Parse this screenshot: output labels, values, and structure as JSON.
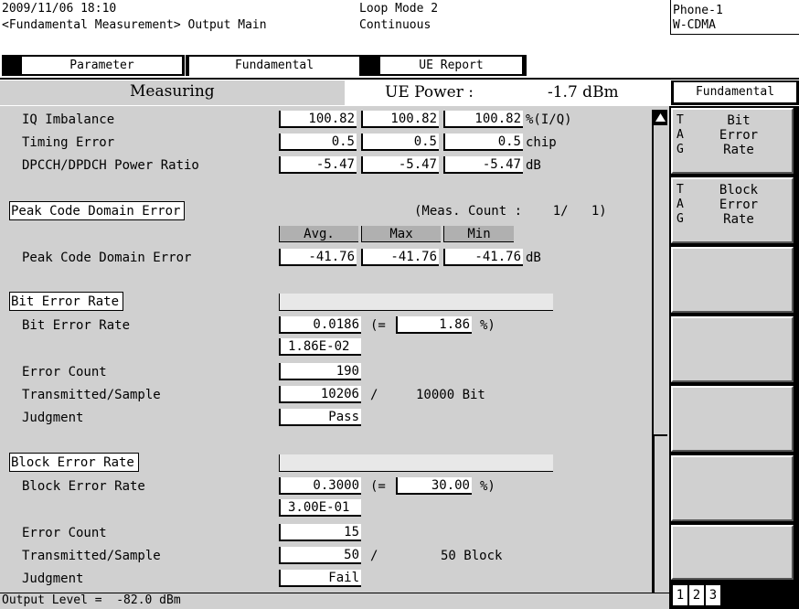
{
  "header": {
    "datetime": "2009/11/06 18:10",
    "screen_title": "<Fundamental Measurement> Output Main",
    "loop_mode": "Loop Mode 2",
    "continuous": "Continuous",
    "phone": "Phone-1",
    "system": "W-CDMA"
  },
  "tabs": [
    {
      "label": "Parameter"
    },
    {
      "label": "Fundamental"
    },
    {
      "label": "UE Report"
    }
  ],
  "status": {
    "measuring": "Measuring",
    "ue_power_label": "UE Power :",
    "ue_power_value": "-1.7 dBm"
  },
  "rows_top": [
    {
      "label": "IQ Imbalance",
      "v1": "100.82",
      "v2": "100.82",
      "v3": "100.82",
      "unit": "%(I/Q)"
    },
    {
      "label": "Timing Error",
      "v1": "0.5",
      "v2": "0.5",
      "v3": "0.5",
      "unit": "chip"
    },
    {
      "label": "DPCCH/DPDCH Power Ratio",
      "v1": "-5.47",
      "v2": "-5.47",
      "v3": "-5.47",
      "unit": "dB"
    }
  ],
  "pcde": {
    "section": "Peak Code Domain Error",
    "meas_count": "(Meas. Count :    1/   1)",
    "h_avg": "Avg.",
    "h_max": "Max",
    "h_min": "Min",
    "label": "Peak Code Domain Error",
    "v1": "-41.76",
    "v2": "-41.76",
    "v3": "-41.76",
    "unit": "dB"
  },
  "ber": {
    "section": "Bit Error Rate",
    "rate_label": "Bit Error Rate",
    "rate_value": "0.0186",
    "paren_open": "(=",
    "percent_value": "1.86",
    "paren_close": "%)",
    "exp_value": "1.86E-02",
    "count_label": "Error Count",
    "count_value": "190",
    "ts_label": "Transmitted/Sample",
    "ts_value": "10206",
    "ts_sep": "/",
    "ts_total": "10000 Bit",
    "judgment_label": "Judgment",
    "judgment_value": "Pass"
  },
  "bler": {
    "section": "Block Error Rate",
    "rate_label": "Block Error Rate",
    "rate_value": "0.3000",
    "paren_open": "(=",
    "percent_value": "30.00",
    "paren_close": "%)",
    "exp_value": "3.00E-01",
    "count_label": "Error Count",
    "count_value": "15",
    "ts_label": "Transmitted/Sample",
    "ts_value": "50",
    "ts_sep": "/",
    "ts_total": "50 Block",
    "judgment_label": "Judgment",
    "judgment_value": "Fail"
  },
  "footer": {
    "output_level": "Output Level =  -82.0 dBm"
  },
  "side": {
    "title": "Fundamental",
    "btn1": {
      "tags": [
        "T",
        "A",
        "G"
      ],
      "label": "Bit\nError\nRate"
    },
    "btn2": {
      "tags": [
        "T",
        "A",
        "G"
      ],
      "label": "Block\nError\nRate"
    },
    "pages": [
      "1",
      "2",
      "3"
    ]
  }
}
